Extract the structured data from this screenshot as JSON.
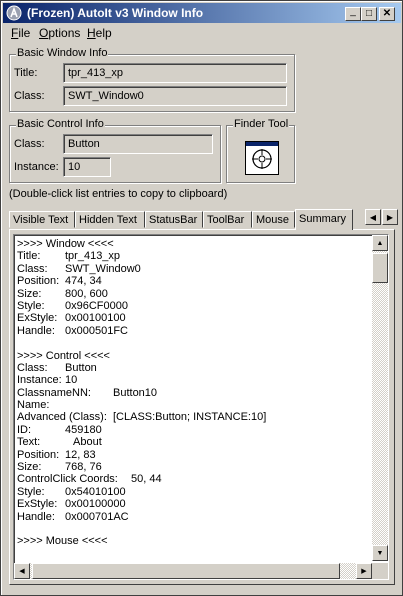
{
  "window": {
    "title": "(Frozen) AutoIt v3 Window Info"
  },
  "titlebar_buttons": {
    "minimize_glyph": "_",
    "maximize_glyph": "□",
    "close_glyph": "✕"
  },
  "menu": [
    {
      "label": "File",
      "underline": "F",
      "rest": "ile"
    },
    {
      "label": "Options",
      "underline": "O",
      "rest": "ptions"
    },
    {
      "label": "Help",
      "underline": "H",
      "rest": "elp"
    }
  ],
  "basic_window": {
    "legend": "Basic Window Info",
    "title_label": "Title:",
    "title_value": "tpr_413_xp",
    "class_label": "Class:",
    "class_value": "SWT_Window0"
  },
  "basic_control": {
    "legend": "Basic Control Info",
    "class_label": "Class:",
    "class_value": "Button",
    "instance_label": "Instance:",
    "instance_value": "10"
  },
  "finder": {
    "legend": "Finder Tool",
    "icon": "crosshair-icon"
  },
  "hint": "(Double-click list entries to copy to clipboard)",
  "tabs": [
    "Visible Text",
    "Hidden Text",
    "StatusBar",
    "ToolBar",
    "Mouse",
    "Summary"
  ],
  "active_tab": "Summary",
  "summary_lines": [
    {
      "k": ">>>> Window <<<<",
      "v": ""
    },
    {
      "k": "Title:",
      "v": "tpr_413_xp"
    },
    {
      "k": "Class:",
      "v": "SWT_Window0"
    },
    {
      "k": "Position:",
      "v": "474, 34"
    },
    {
      "k": "Size:",
      "v": "800, 600"
    },
    {
      "k": "Style:",
      "v": "0x96CF0000"
    },
    {
      "k": "ExStyle:",
      "v": "0x00100100"
    },
    {
      "k": "Handle:",
      "v": "0x000501FC"
    },
    {
      "k": "",
      "v": ""
    },
    {
      "k": ">>>> Control <<<<",
      "v": ""
    },
    {
      "k": "Class:",
      "v": "Button"
    },
    {
      "k": "Instance:",
      "v": "10"
    },
    {
      "k": "ClassnameNN:",
      "v": "Button10"
    },
    {
      "k": "Name:",
      "v": ""
    },
    {
      "k": "Advanced (Class):",
      "v": "[CLASS:Button; INSTANCE:10]"
    },
    {
      "k": "ID:",
      "v": "459180"
    },
    {
      "k": "Text:",
      "v": "About"
    },
    {
      "k": "Position:",
      "v": "12, 83"
    },
    {
      "k": "Size:",
      "v": "768, 76"
    },
    {
      "k": "ControlClick Coords:",
      "v": "50, 44"
    },
    {
      "k": "Style:",
      "v": "0x54010100"
    },
    {
      "k": "ExStyle:",
      "v": "0x00100000"
    },
    {
      "k": "Handle:",
      "v": "0x000701AC"
    },
    {
      "k": "",
      "v": ""
    },
    {
      "k": ">>>> Mouse <<<<",
      "v": ""
    }
  ]
}
